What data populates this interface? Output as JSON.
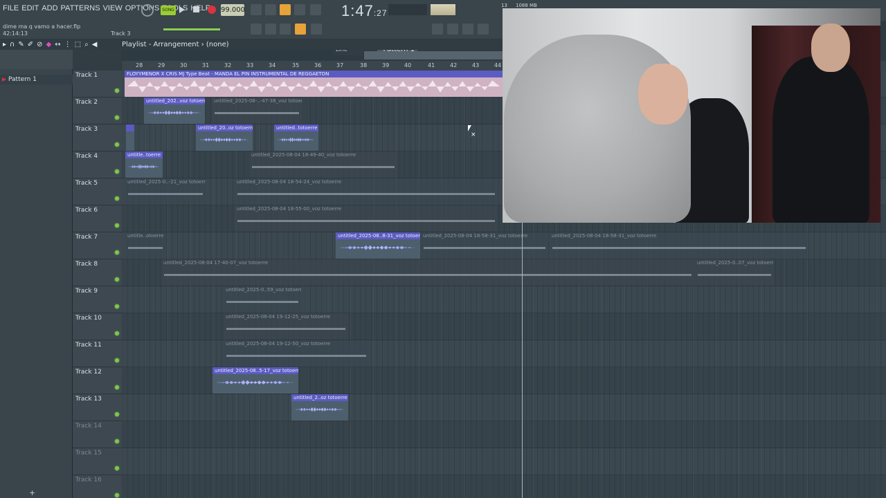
{
  "menu": [
    "FILE",
    "EDIT",
    "ADD",
    "PATTERNS",
    "VIEW",
    "OPTIONS",
    "TOOLS",
    "HELP"
  ],
  "transport": {
    "song_label": "SONG",
    "tempo": "99.000",
    "time": "1:47",
    "time_small": ":27",
    "cpu": "13",
    "memory": "1088 MB"
  },
  "hint": {
    "line1": "dime ma q vamo a  hacer.flp",
    "line2": "42:14:13",
    "track_hint": "Track 3"
  },
  "pattern": {
    "selector": "Pattern 1",
    "snap": "Line",
    "browser_item": "Pattern 1"
  },
  "playlist": {
    "title": "Playlist - Arrangement",
    "arrow": "›",
    "pattern_name": "(none)"
  },
  "ruler": [
    "28",
    "29",
    "30",
    "31",
    "32",
    "33",
    "34",
    "35",
    "36",
    "37",
    "38",
    "39",
    "40",
    "41",
    "42",
    "43",
    "44"
  ],
  "tracks": [
    "Track 1",
    "Track 2",
    "Track 3",
    "Track 4",
    "Track 5",
    "Track 6",
    "Track 7",
    "Track 8",
    "Track 9",
    "Track 10",
    "Track 11",
    "Track 12",
    "Track 13",
    "Track 14",
    "Track 15",
    "Track 16"
  ],
  "clips": {
    "beat": "FLOYYMENOR X CRIS MJ Type Beat - MANDA EL PIN  INSTRUMENTAL DE REGGAETON",
    "t2a": "untitled_202..voz totoerre",
    "t2b": "untitled_2025-08-..-47-38_voz totoerre",
    "t3a": "",
    "t3b": "untitled_20..oz totoerre",
    "t3c": "untitled..totoerre",
    "t4a": "untitle..toerre",
    "t4b": "untitled_2025-08-04 18-49-40_voz totoerre",
    "t5a": "untitled_2025-0..-21_voz totoerre",
    "t5b": "untitled_2025-08-04 18-54-24_voz totoerre",
    "t6a": "untitled_2025-08-04 18-55-00_voz totoerre",
    "t7a": "untitle..otoerre",
    "t7b": "untitled_2025-08..8-31_voz totoerre",
    "t7c": "untitled_2025-08-04 18-58-31_voz totoerre",
    "t7d": "untitled_2025-08-04 18-58-31_voz totoerre",
    "t8a": "untitled_2025-08-04 17-40-07_voz totoerre",
    "t8b": "untitled_2025-0..07_voz totoerre",
    "t9a": "untitled_2025-0..59_voz totoerre",
    "t10a": "untitled_2025-08-04 19-12-25_voz totoerre",
    "t11a": "untitled_2025-08-04 19-12-50_voz totoerre",
    "t12a": "untitled_2025-08..5-17_voz totoerre",
    "t13a": "untitled_2..oz totoerre"
  },
  "colors": {
    "clip_active": "#5b5bc2",
    "wave": "#b3b6ff",
    "beat": "#cfb3c3",
    "led": "#7fc74a",
    "record": "#d9343f"
  }
}
